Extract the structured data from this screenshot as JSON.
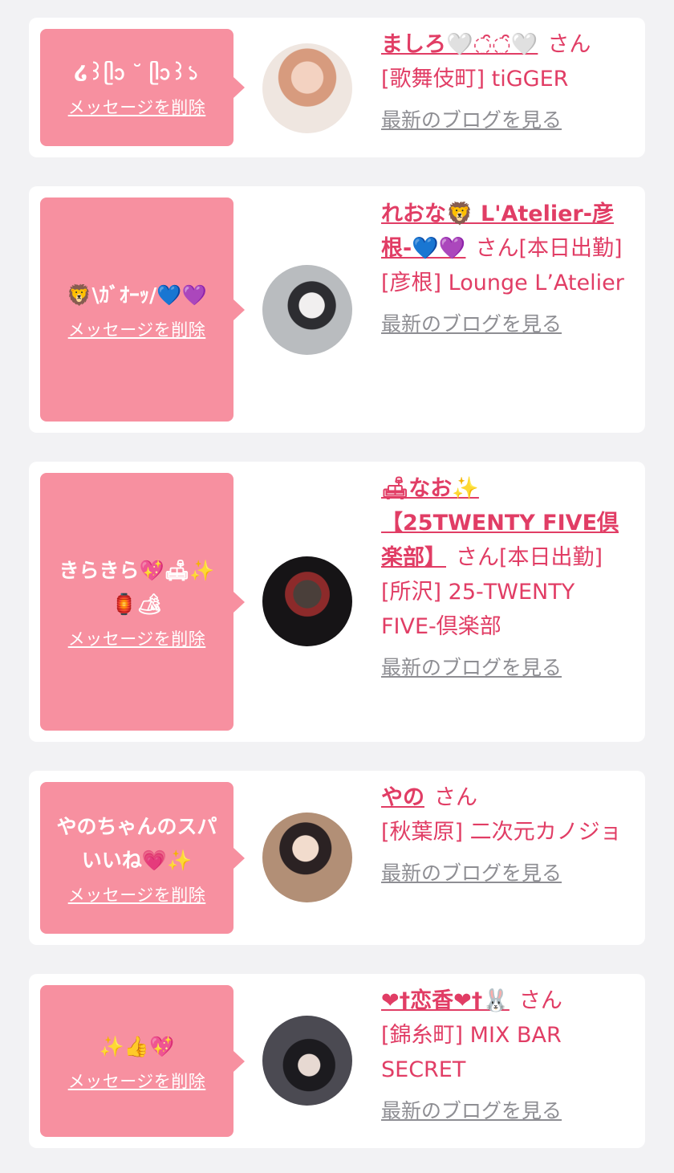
{
  "delete_label": "メッセージを削除",
  "blog_label": "最新のブログを見る",
  "san_suffix": "さん",
  "colors": {
    "accent": "#e13d65",
    "bubble": "#f790a0",
    "link_gray": "#8e8e93",
    "background": "#f2f2f4"
  },
  "items": [
    {
      "message": "໒꒱ᥫᩣ ˘ ᥫᩣ꒱১",
      "name": "ましろ🤍◌̑◌̑🤍",
      "status": "",
      "shop": "[歌舞伎町] tiGGER",
      "avatar_icon": "avatar-photo"
    },
    {
      "message": "🦁\\ｶﾞｵｰｯ/💙💜",
      "name": "れおな🦁 L'Atelier-彦根-💙💜",
      "status": "[本日出勤]",
      "shop": "[彦根] Lounge L’Atelier",
      "avatar_icon": "avatar-photo"
    },
    {
      "message": "きらきら💖🛋✨🏮🏕",
      "name": "🛋なお✨【25TWENTY FIVE倶楽部】",
      "status": "[本日出勤]",
      "shop": "[所沢] 25-TWENTY FIVE-倶楽部",
      "avatar_icon": "avatar-photo"
    },
    {
      "message": "やのちゃんのスパいいね💗✨",
      "name": "やの",
      "status": "",
      "shop": "[秋葉原] 二次元カノジョ",
      "avatar_icon": "avatar-photo"
    },
    {
      "message": "✨👍💖",
      "name": "❤︎†恋香❤︎†🐰",
      "status": "",
      "shop": "[錦糸町] MIX BAR SECRET",
      "avatar_icon": "avatar-photo"
    }
  ]
}
